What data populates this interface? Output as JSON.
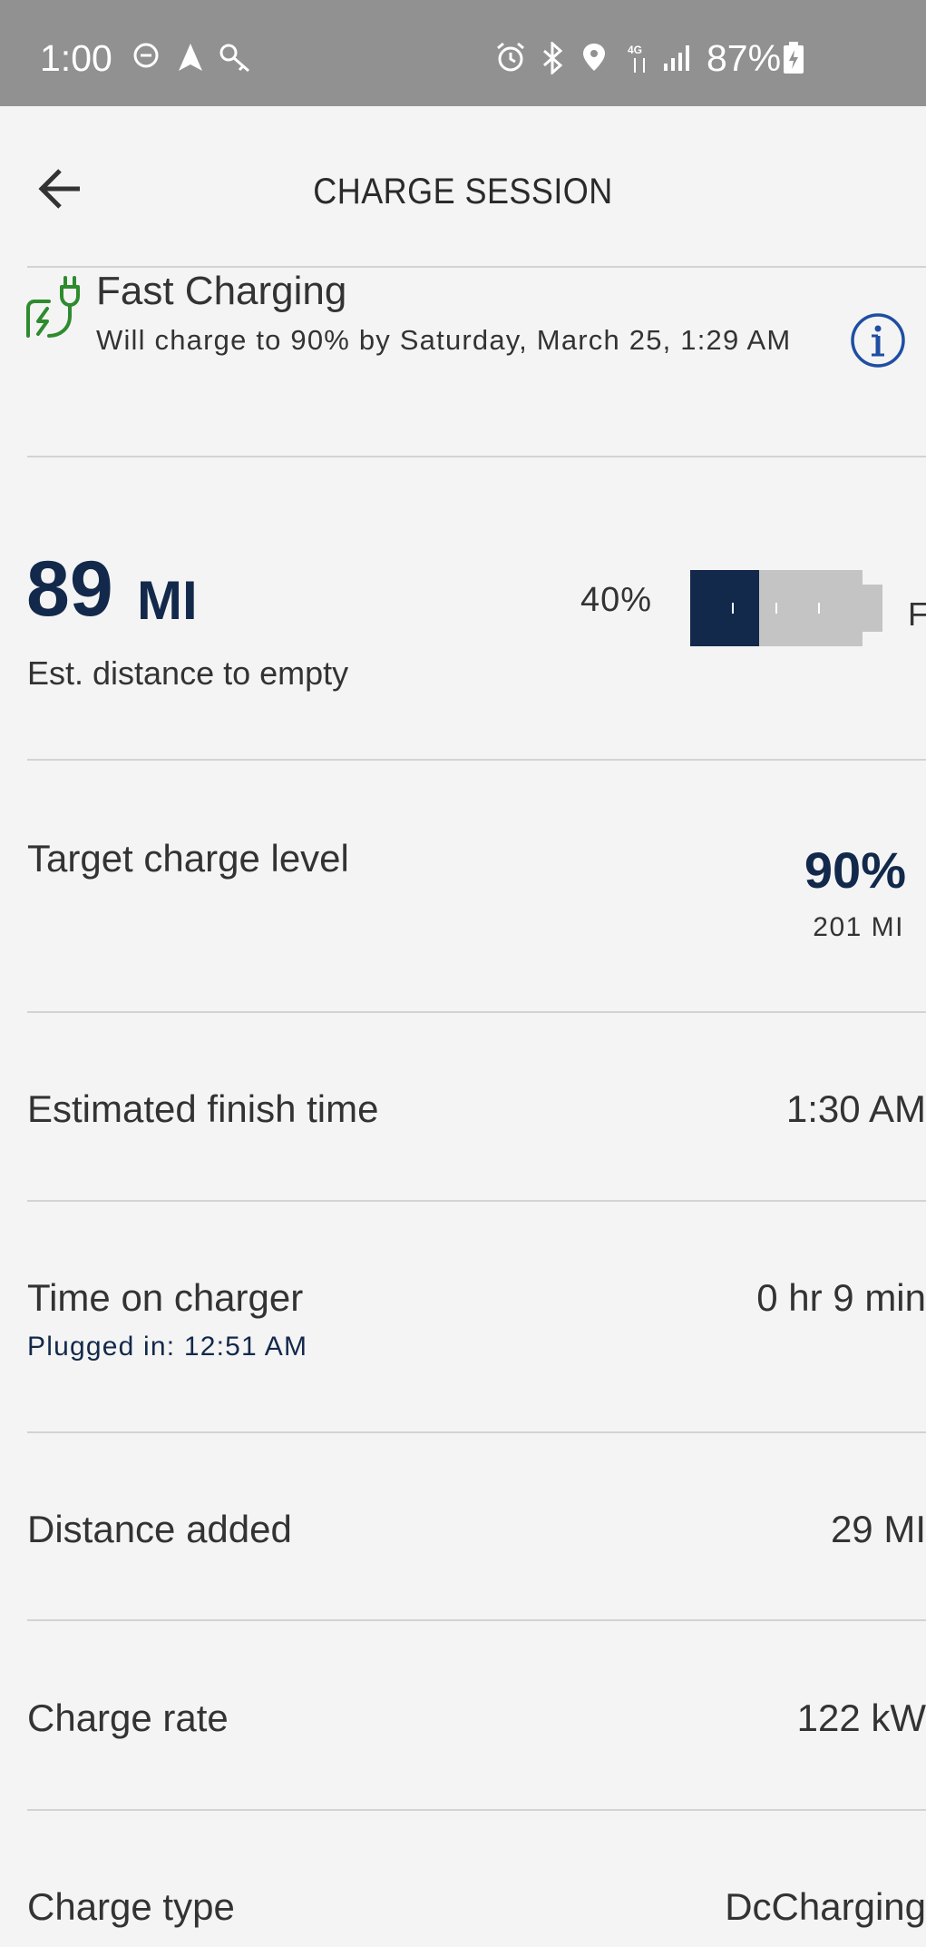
{
  "status_bar": {
    "time": "1:00",
    "battery_percent": "87%",
    "icons": [
      "do-not-disturb-icon",
      "navigation-icon",
      "key-icon",
      "alarm-icon",
      "bluetooth-icon",
      "location-icon",
      "4g-lte-icon",
      "signal-icon",
      "battery-charging-icon"
    ]
  },
  "header": {
    "title": "CHARGE SESSION",
    "back_icon": "arrow-left-icon"
  },
  "fast_charging": {
    "title": "Fast Charging",
    "subtitle": "Will charge to 90% by Saturday, March 25, 1:29 AM",
    "plug_icon": "ev-plug-icon",
    "info_icon": "info-icon"
  },
  "range": {
    "value": "89",
    "unit": "MI",
    "label": "Est. distance to empty",
    "battery_percent": "40%",
    "battery_fill_fraction": 0.4,
    "full_label": "F"
  },
  "target": {
    "label": "Target charge level",
    "percent": "90%",
    "miles": "201 MI"
  },
  "finish": {
    "label": "Estimated finish time",
    "value": "1:30 AM"
  },
  "time_on_charger": {
    "label": "Time on charger",
    "value": "0 hr 9 min",
    "plugged_in": "Plugged in: 12:51 AM"
  },
  "distance_added": {
    "label": "Distance added",
    "value": "29 MI"
  },
  "charge_rate": {
    "label": "Charge rate",
    "value": "122 kW"
  },
  "charge_type": {
    "label": "Charge type",
    "value": "DcCharging"
  },
  "colors": {
    "navy": "#13294b",
    "green": "#2e8b2e",
    "info_blue": "#1f4ea3",
    "status_bar": "#919191"
  }
}
